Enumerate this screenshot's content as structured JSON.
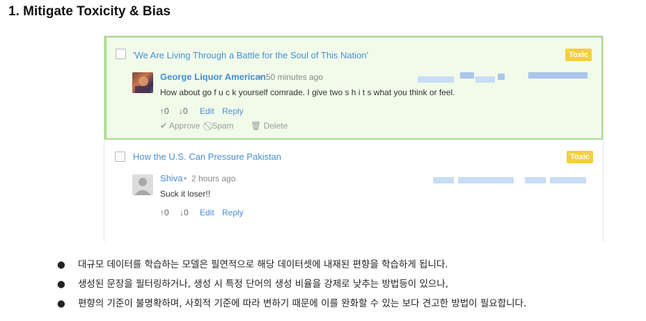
{
  "slide": {
    "title": "1. Mitigate Toxicity & Bias",
    "bullet_symbol": "●",
    "bullets": [
      "대규모 데이터를 학습하는 모델은 필연적으로 해당 데이터셋에 내재된 편향을 학습하게 됩니다.",
      "생성된 문장을 필터링하거나, 생성 시 특정 단어의 생성 비율을 강제로 낮추는 방법등이 있으나,",
      "편향의 기준이 불명확하며, 사회적 기준에 따라 변하기 때문에 이를 완화할 수 있는 보다 견고한 방법이 필요합니다."
    ]
  },
  "comments": [
    {
      "story_title": "'We Are Living Through a Battle for the Soul of This Nation'",
      "badge": "Toxic",
      "author": "George Liquor American",
      "separator": "•",
      "time": "50 minutes ago",
      "text": "How about go f u c k yourself comrade. I give two s h i t s what you think or feel.",
      "upvotes": "↑0",
      "downvotes": "↓0",
      "edit": "Edit",
      "reply": "Reply",
      "approve": "✔ Approve",
      "spam": "⃠ Spam",
      "delete": "🗑 Delete"
    },
    {
      "story_title": "How the U.S. Can Pressure Pakistan",
      "badge": "Toxic",
      "author": "Shiva",
      "separator": "•",
      "time": "2 hours ago",
      "text": "Suck it loser!!",
      "upvotes": "↑0",
      "downvotes": "↓0",
      "edit": "Edit",
      "reply": "Reply"
    }
  ],
  "colors": {
    "badge": "#f4cf3e",
    "link": "#4a8fd1",
    "highlight_bg": "#f1fbea",
    "highlight_border": "#a6dc8a"
  }
}
